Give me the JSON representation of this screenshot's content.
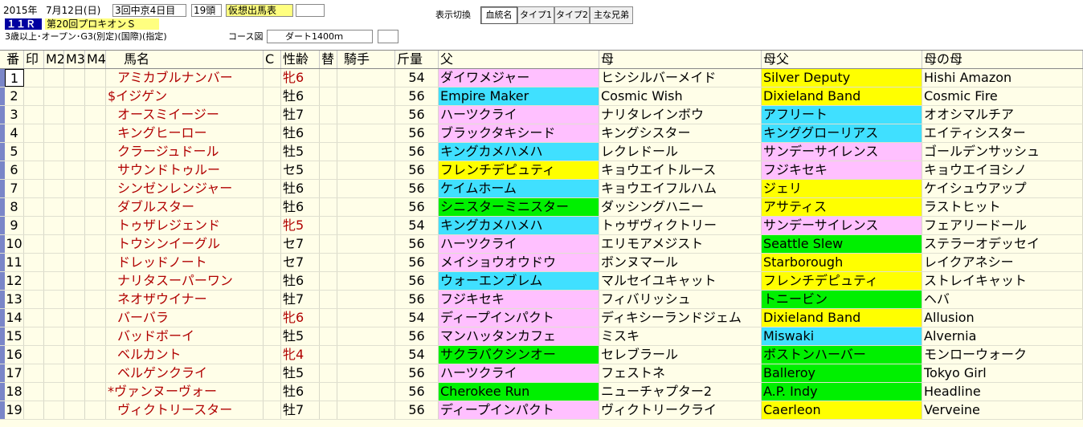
{
  "race_info": {
    "year": "2015年",
    "date": "7月12日(日)",
    "meeting": "3回中京4日目",
    "runners": "19頭",
    "status": "仮想出馬表",
    "race_no": "１１Ｒ",
    "race_name": "第20回プロキオンＳ",
    "conditions": "3歳以上･オープン･G3(別定)(国際)(指定)",
    "course_label": "コース図",
    "course": "ダート1400ｍ"
  },
  "toolbar": {
    "label": "表示切換",
    "buttons": [
      "血統名",
      "タイプ1",
      "タイプ2",
      "主な兄弟"
    ],
    "active": "血統名"
  },
  "headers": [
    "番",
    "印",
    "M2",
    "M3",
    "M4",
    "馬名",
    "C",
    "性齢",
    "替",
    "騎手",
    "斤量",
    "父",
    "母",
    "母父",
    "母の母"
  ],
  "colors": {
    "pink": "#ffc0ff",
    "cyan": "#40e0ff",
    "yellow": "#ffff00",
    "green": "#00f000",
    "red": "#b00000"
  },
  "rows": [
    {
      "no": "1",
      "name": "アミカブルナンバー",
      "sex": "牝6",
      "weight": "54",
      "sire": "ダイワメジャー",
      "dam": "ヒシシルバーメイド",
      "damsire": "Silver Deputy",
      "damdam": "Hishi Amazon",
      "sire_color": "pink",
      "damsire_color": "yellow",
      "female": true
    },
    {
      "no": "2",
      "name": "$イジゲン",
      "sex": "牡6",
      "weight": "56",
      "sire": "Empire Maker",
      "dam": "Cosmic Wish",
      "damsire": "Dixieland Band",
      "damdam": "Cosmic Fire",
      "sire_color": "cyan",
      "damsire_color": "yellow",
      "female": false
    },
    {
      "no": "3",
      "name": "オースミイージー",
      "sex": "牡7",
      "weight": "56",
      "sire": "ハーツクライ",
      "dam": "ナリタレインボウ",
      "damsire": "アフリート",
      "damdam": "オオシマルチア",
      "sire_color": "pink",
      "damsire_color": "cyan",
      "female": false
    },
    {
      "no": "4",
      "name": "キングヒーロー",
      "sex": "牡6",
      "weight": "56",
      "sire": "ブラックタキシード",
      "dam": "キングシスター",
      "damsire": "キンググローリアス",
      "damdam": "エイティシスター",
      "sire_color": "pink",
      "damsire_color": "cyan",
      "female": false
    },
    {
      "no": "5",
      "name": "クラージュドール",
      "sex": "牡5",
      "weight": "56",
      "sire": "キングカメハメハ",
      "dam": "レクレドール",
      "damsire": "サンデーサイレンス",
      "damdam": "ゴールデンサッシュ",
      "sire_color": "cyan",
      "damsire_color": "pink",
      "female": false
    },
    {
      "no": "6",
      "name": "サウンドトゥルー",
      "sex": "セ5",
      "weight": "56",
      "sire": "フレンチデピュティ",
      "dam": "キョウエイトルース",
      "damsire": "フジキセキ",
      "damdam": "キョウエイヨシノ",
      "sire_color": "yellow",
      "damsire_color": "pink",
      "female": false
    },
    {
      "no": "7",
      "name": "シンゼンレンジャー",
      "sex": "牡6",
      "weight": "56",
      "sire": "ケイムホーム",
      "dam": "キョウエイフルハム",
      "damsire": "ジェリ",
      "damdam": "ケイシュウアップ",
      "sire_color": "cyan",
      "damsire_color": "yellow",
      "female": false
    },
    {
      "no": "8",
      "name": "ダブルスター",
      "sex": "牡6",
      "weight": "56",
      "sire": "シニスターミニスター",
      "dam": "ダッシングハニー",
      "damsire": "アサティス",
      "damdam": "ラストヒット",
      "sire_color": "green",
      "damsire_color": "yellow",
      "female": false
    },
    {
      "no": "9",
      "name": "トゥザレジェンド",
      "sex": "牝5",
      "weight": "54",
      "sire": "キングカメハメハ",
      "dam": "トゥザヴィクトリー",
      "damsire": "サンデーサイレンス",
      "damdam": "フェアリードール",
      "sire_color": "cyan",
      "damsire_color": "pink",
      "female": true
    },
    {
      "no": "10",
      "name": "トウシンイーグル",
      "sex": "セ7",
      "weight": "56",
      "sire": "ハーツクライ",
      "dam": "エリモアメジスト",
      "damsire": "Seattle Slew",
      "damdam": "ステラーオデッセイ",
      "sire_color": "pink",
      "damsire_color": "green",
      "female": false
    },
    {
      "no": "11",
      "name": "ドレッドノート",
      "sex": "セ7",
      "weight": "56",
      "sire": "メイショウオウドウ",
      "dam": "ボンヌマール",
      "damsire": "Starborough",
      "damdam": "レイクアネシー",
      "sire_color": "pink",
      "damsire_color": "yellow",
      "female": false
    },
    {
      "no": "12",
      "name": "ナリタスーパーワン",
      "sex": "牡6",
      "weight": "56",
      "sire": "ウォーエンブレム",
      "dam": "マルセイユキャット",
      "damsire": "フレンチデピュティ",
      "damdam": "ストレイキャット",
      "sire_color": "cyan",
      "damsire_color": "yellow",
      "female": false
    },
    {
      "no": "13",
      "name": "ネオザウイナー",
      "sex": "牡7",
      "weight": "56",
      "sire": "フジキセキ",
      "dam": "フィバリッシュ",
      "damsire": "トニービン",
      "damdam": "ヘバ",
      "sire_color": "pink",
      "damsire_color": "green",
      "female": false
    },
    {
      "no": "14",
      "name": "バーバラ",
      "sex": "牝6",
      "weight": "54",
      "sire": "ディープインパクト",
      "dam": "ディキシーランドジェム",
      "damsire": "Dixieland Band",
      "damdam": "Allusion",
      "sire_color": "pink",
      "damsire_color": "yellow",
      "female": true
    },
    {
      "no": "15",
      "name": "バッドボーイ",
      "sex": "牡5",
      "weight": "56",
      "sire": "マンハッタンカフェ",
      "dam": "ミスキ",
      "damsire": "Miswaki",
      "damdam": "Alvernia",
      "sire_color": "pink",
      "damsire_color": "cyan",
      "female": false
    },
    {
      "no": "16",
      "name": "ベルカント",
      "sex": "牝4",
      "weight": "54",
      "sire": "サクラバクシンオー",
      "dam": "セレブラール",
      "damsire": "ボストンハーバー",
      "damdam": "モンローウォーク",
      "sire_color": "green",
      "damsire_color": "green",
      "female": true
    },
    {
      "no": "17",
      "name": "ベルゲンクライ",
      "sex": "牡5",
      "weight": "56",
      "sire": "ハーツクライ",
      "dam": "フェストネ",
      "damsire": "Balleroy",
      "damdam": "Tokyo Girl",
      "sire_color": "pink",
      "damsire_color": "green",
      "female": false
    },
    {
      "no": "18",
      "name": "*ヴァンヌーヴォー",
      "sex": "牡6",
      "weight": "56",
      "sire": "Cherokee Run",
      "dam": "ニューチャプター2",
      "damsire": "A.P. Indy",
      "damdam": "Headline",
      "sire_color": "green",
      "damsire_color": "green",
      "female": false
    },
    {
      "no": "19",
      "name": "ヴィクトリースター",
      "sex": "牡7",
      "weight": "56",
      "sire": "ディープインパクト",
      "dam": "ヴィクトリークライ",
      "damsire": "Caerleon",
      "damdam": "Verveine",
      "sire_color": "pink",
      "damsire_color": "yellow",
      "female": false
    }
  ]
}
